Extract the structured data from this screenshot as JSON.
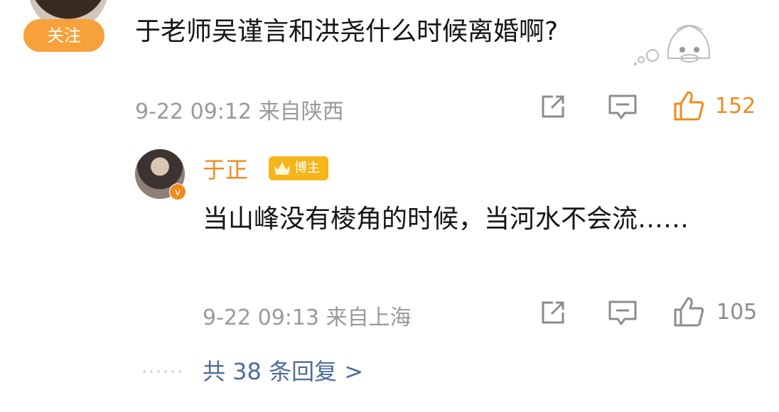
{
  "comment": {
    "follow_label": "关注",
    "text": "于老师吴谨言和洪尧什么时候离婚啊?",
    "time": "9-22 09:12",
    "location": "来自陕西",
    "likes": "152",
    "liked": true
  },
  "reply": {
    "author": "于正",
    "badge": "博主",
    "text": "当山峰没有棱角的时候，当河水不会流……",
    "time": "9-22 09:13",
    "location": "来自上海",
    "likes": "105",
    "liked": false
  },
  "replies_link": "共 38 条回复 >",
  "colors": {
    "accent_orange": "#f08a1c",
    "follow_button": "#f7a13a",
    "badge_gold": "#f6b51b",
    "link_blue": "#4d6c9a",
    "meta_gray": "#9a9a9a"
  }
}
